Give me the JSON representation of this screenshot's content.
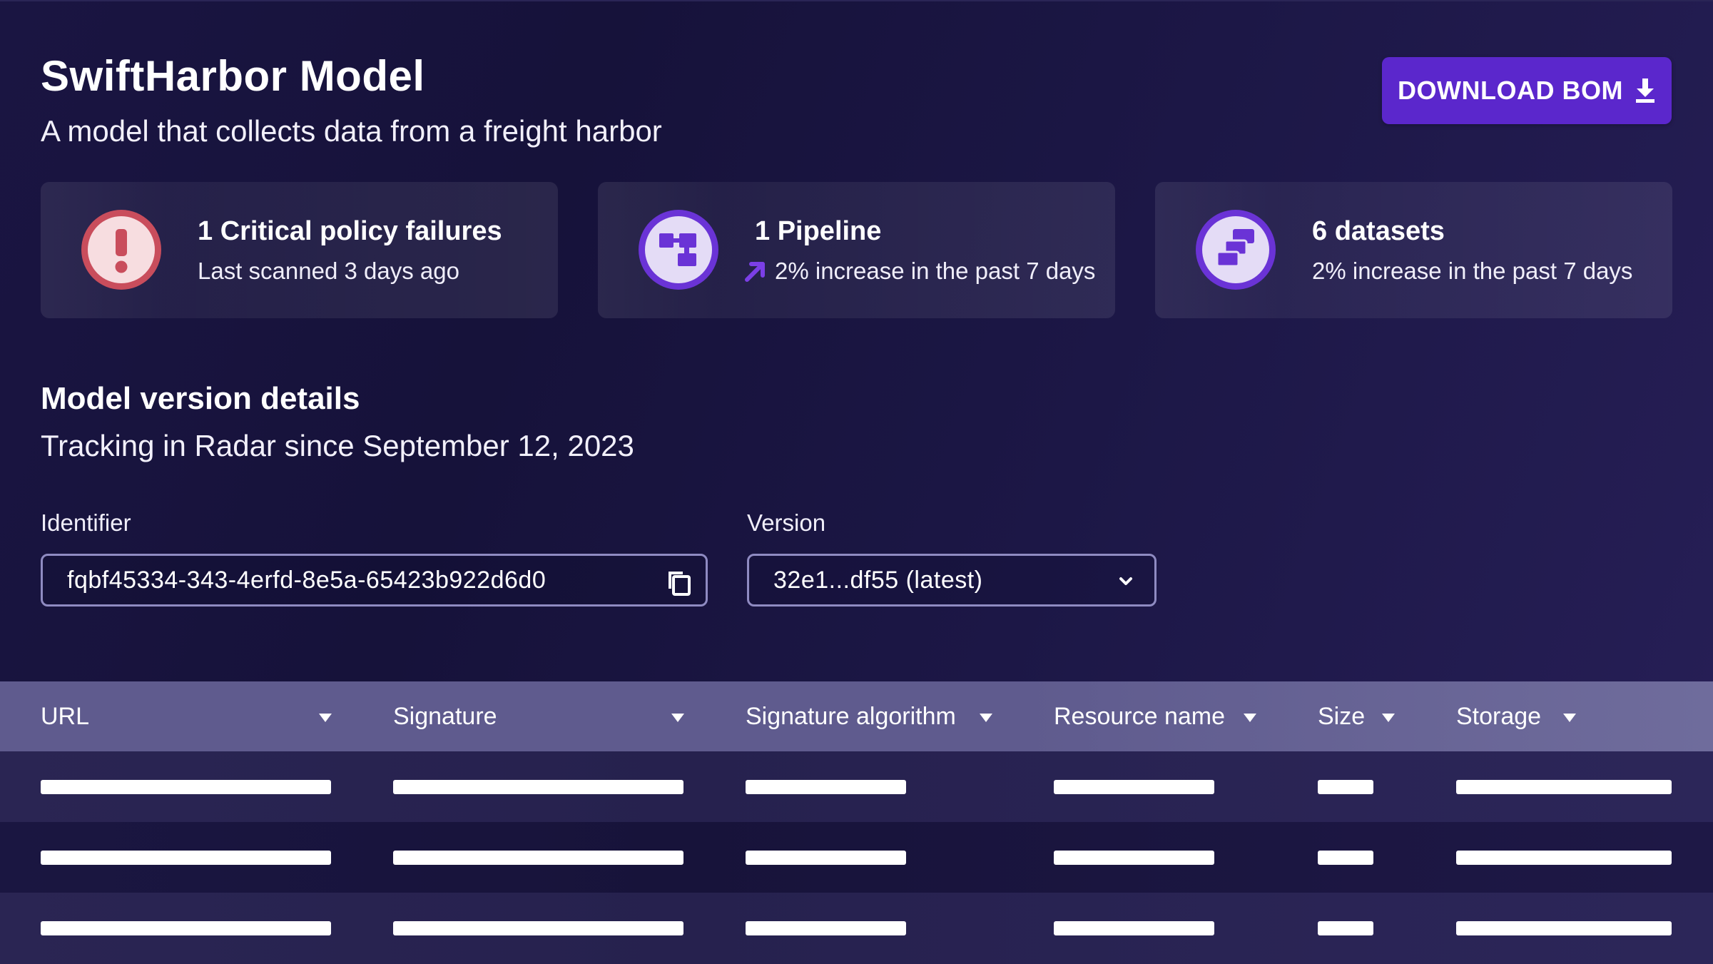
{
  "header": {
    "title": "SwiftHarbor Model",
    "subtitle": "A model that collects data from a freight harbor",
    "download_label": "DOWNLOAD BOM"
  },
  "cards": [
    {
      "title": "1 Critical policy failures",
      "subtitle": "Last scanned 3 days ago",
      "icon": "alert-exclamation-icon"
    },
    {
      "title": "1 Pipeline",
      "subtitle": "2% increase in the past 7 days",
      "icon": "pipeline-icon",
      "trend": "up-right-arrow-icon"
    },
    {
      "title": "6 datasets",
      "subtitle": "2% increase in the past 7 days",
      "icon": "datasets-icon"
    }
  ],
  "version_details": {
    "title": "Model version details",
    "subtitle": "Tracking in Radar since September 12, 2023",
    "identifier_label": "Identifier",
    "identifier_value": "fqbf45334-343-4erfd-8e5a-65423b922d6d0",
    "version_label": "Version",
    "version_value": "32e1...df55 (latest)"
  },
  "table": {
    "columns": [
      "URL",
      "Signature",
      "Signature algorithm",
      "Resource name",
      "Size",
      "Storage"
    ],
    "row_count": 3
  },
  "colors": {
    "accent": "#5b27cc",
    "alert": "#c94d5c",
    "icon_ring": "#6a33d6",
    "header_bg": "#5f5b8e"
  }
}
